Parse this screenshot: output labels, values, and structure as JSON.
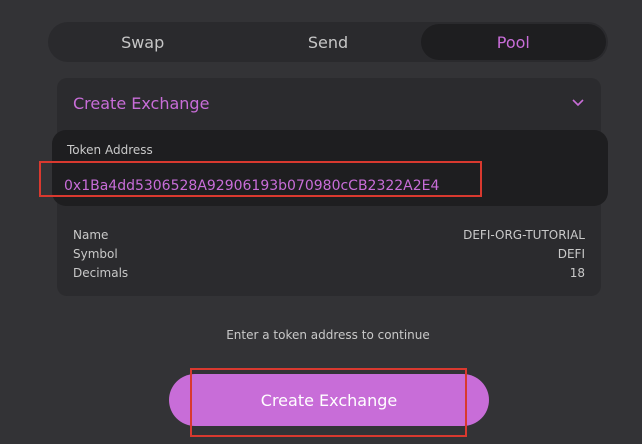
{
  "tabs": [
    {
      "label": "Swap"
    },
    {
      "label": "Send"
    },
    {
      "label": "Pool"
    }
  ],
  "active_tab": "Pool",
  "panel": {
    "title": "Create Exchange",
    "chevron_icon": "chevron-down-icon"
  },
  "token_address": {
    "label": "Token Address",
    "value": "0x1Ba4dd5306528A92906193b070980cCB2322A2E4"
  },
  "details": [
    {
      "label": "Name",
      "value": "DEFI-ORG-TUTORIAL"
    },
    {
      "label": "Symbol",
      "value": "DEFI"
    },
    {
      "label": "Decimals",
      "value": "18"
    }
  ],
  "hint": "Enter a token address to continue",
  "button": {
    "label": "Create Exchange"
  },
  "colors": {
    "accent": "#c86dd8",
    "background": "#333336",
    "highlight": "#d9392f"
  }
}
